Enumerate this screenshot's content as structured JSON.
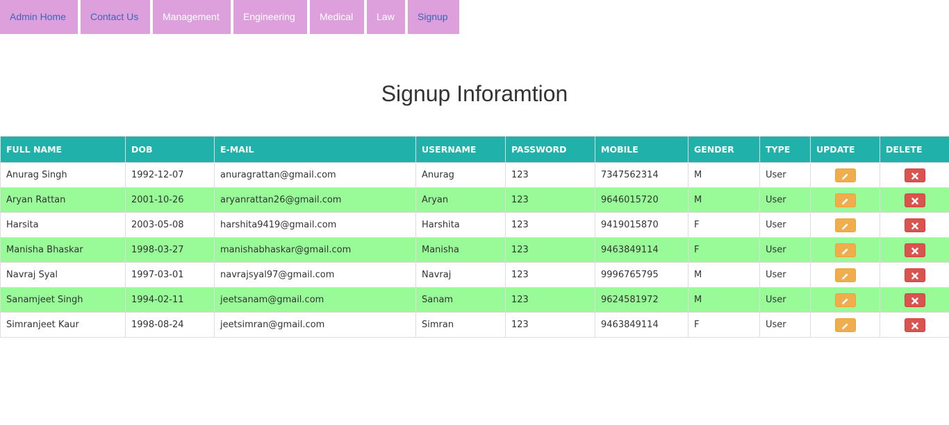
{
  "nav": {
    "items": [
      {
        "label": "Admin Home"
      },
      {
        "label": "Contact Us"
      },
      {
        "label": "Management"
      },
      {
        "label": "Engineering"
      },
      {
        "label": "Medical"
      },
      {
        "label": "Law"
      },
      {
        "label": "Signup"
      }
    ]
  },
  "page": {
    "title": "Signup Inforamtion"
  },
  "table": {
    "headers": [
      "FULL NAME",
      "DOB",
      "E-MAIL",
      "USERNAME",
      "PASSWORD",
      "MOBILE",
      "GENDER",
      "TYPE",
      "UPDATE",
      "DELETE"
    ],
    "rows": [
      {
        "name": "Anurag Singh",
        "dob": "1992-12-07",
        "email": "anuragrattan@gmail.com",
        "username": "Anurag",
        "password": "123",
        "mobile": "7347562314",
        "gender": "M",
        "type": "User"
      },
      {
        "name": "Aryan Rattan",
        "dob": "2001-10-26",
        "email": "aryanrattan26@gmail.com",
        "username": "Aryan",
        "password": "123",
        "mobile": "9646015720",
        "gender": "M",
        "type": "User"
      },
      {
        "name": "Harsita",
        "dob": "2003-05-08",
        "email": "harshita9419@gmail.com",
        "username": "Harshita",
        "password": "123",
        "mobile": "9419015870",
        "gender": "F",
        "type": "User"
      },
      {
        "name": "Manisha Bhaskar",
        "dob": "1998-03-27",
        "email": "manishabhaskar@gmail.com",
        "username": "Manisha",
        "password": "123",
        "mobile": "9463849114",
        "gender": "F",
        "type": "User"
      },
      {
        "name": "Navraj Syal",
        "dob": "1997-03-01",
        "email": "navrajsyal97@gmail.com",
        "username": "Navraj",
        "password": "123",
        "mobile": "9996765795",
        "gender": "M",
        "type": "User"
      },
      {
        "name": "Sanamjeet Singh",
        "dob": "1994-02-11",
        "email": "jeetsanam@gmail.com",
        "username": "Sanam",
        "password": "123",
        "mobile": "9624581972",
        "gender": "M",
        "type": "User"
      },
      {
        "name": "Simranjeet Kaur",
        "dob": "1998-08-24",
        "email": "jeetsimran@gmail.com",
        "username": "Simran",
        "password": "123",
        "mobile": "9463849114",
        "gender": "F",
        "type": "User"
      }
    ]
  },
  "colors": {
    "nav_bg": "#dda0dd",
    "nav_link_blue": "#3a66b5",
    "header_bg": "#20b2aa",
    "alt_row_bg": "#98fb98",
    "update_button": "#f0ad4e",
    "delete_button": "#d9534f"
  },
  "icons": {
    "update": "pencil-icon",
    "delete": "close-icon"
  }
}
